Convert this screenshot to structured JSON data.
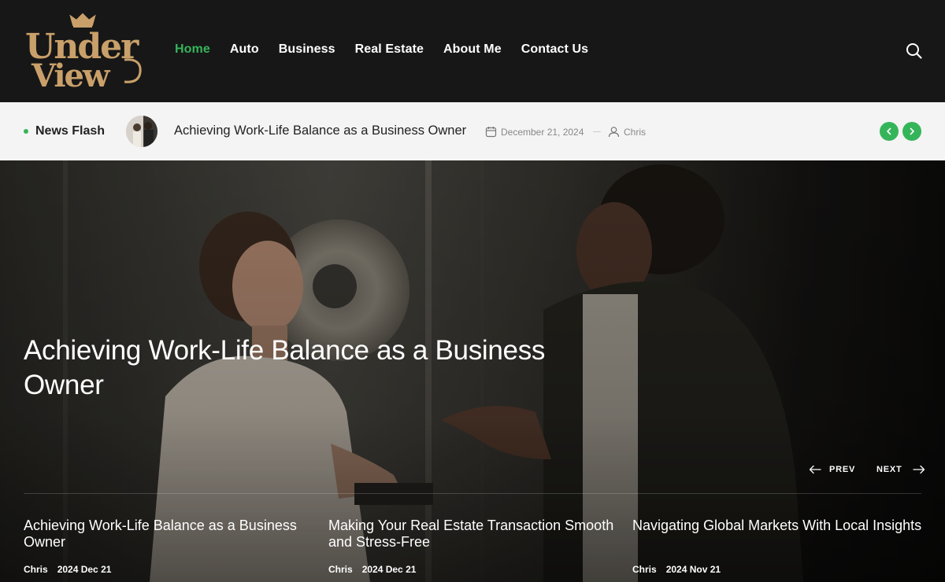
{
  "brand": {
    "logo_line1": "Under",
    "logo_line2": "View"
  },
  "nav": {
    "items": [
      {
        "label": "Home",
        "active": true
      },
      {
        "label": "Auto"
      },
      {
        "label": "Business"
      },
      {
        "label": "Real Estate"
      },
      {
        "label": "About Me"
      },
      {
        "label": "Contact Us"
      }
    ]
  },
  "flash": {
    "label": "News Flash",
    "title": "Achieving Work-Life Balance as a Business Owner",
    "date": "December 21, 2024",
    "author": "Chris"
  },
  "hero": {
    "title": "Achieving Work-Life Balance as a Business Owner",
    "prev_label": "PREV",
    "next_label": "NEXT"
  },
  "cards": [
    {
      "title": "Achieving Work-Life Balance as a Business Owner",
      "author": "Chris",
      "date": "2024 Dec 21"
    },
    {
      "title": "Making Your Real Estate Transaction Smooth and Stress-Free",
      "author": "Chris",
      "date": "2024 Dec 21"
    },
    {
      "title": "Navigating Global Markets With Local Insights",
      "author": "Chris",
      "date": "2024 Nov 21"
    }
  ],
  "colors": {
    "accent": "#35b55a",
    "header_bg": "#171717",
    "flash_bg": "#f4f4f4",
    "logo_gold": "#c9a06a"
  }
}
